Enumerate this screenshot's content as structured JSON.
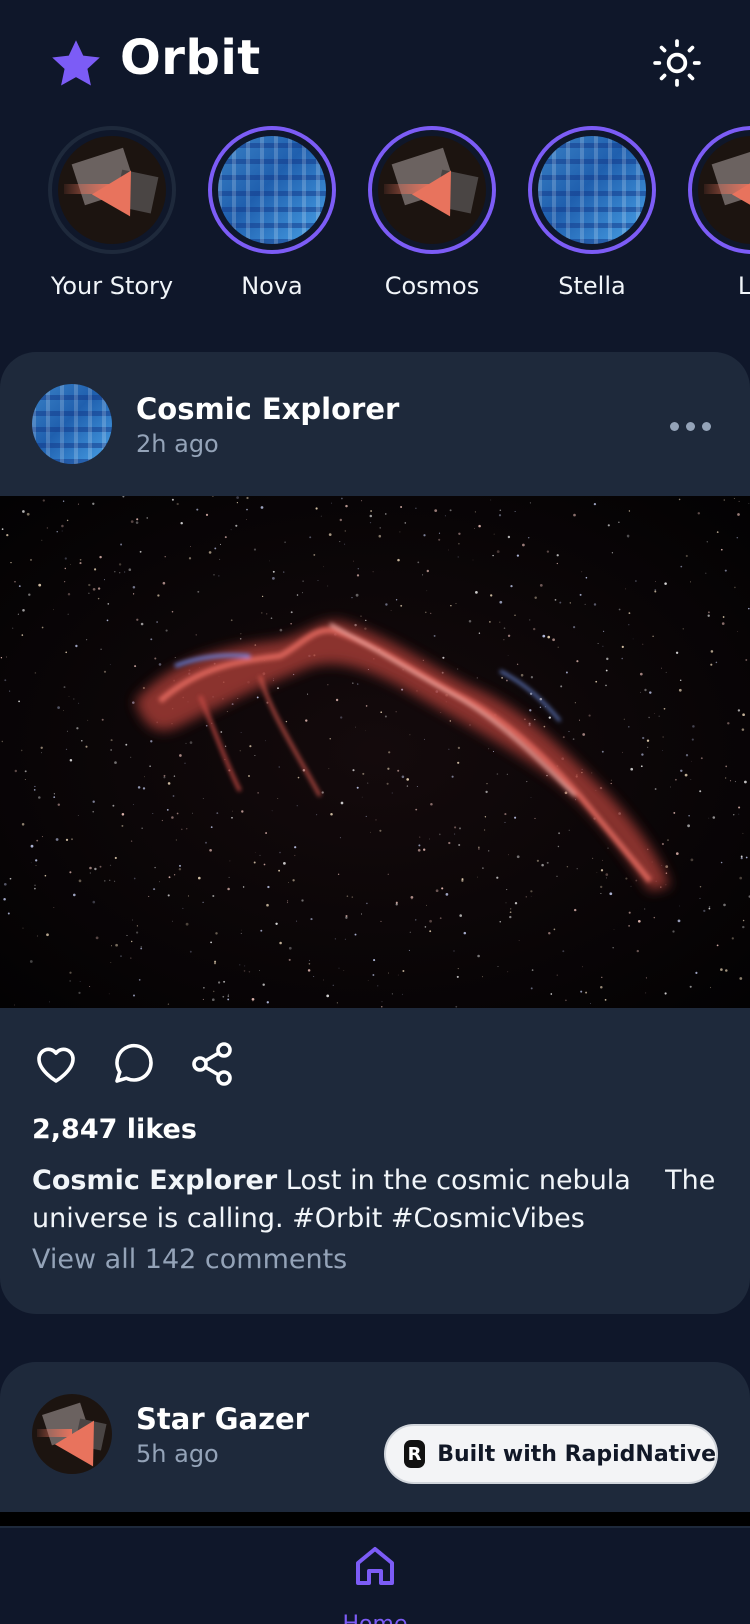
{
  "app": {
    "title": "Orbit",
    "accent_color": "#7c5cf6",
    "logo_icon": "star-icon",
    "theme_icon": "sun-icon"
  },
  "stories": [
    {
      "name": "Your Story",
      "avatar": "dark-shards",
      "own": true
    },
    {
      "name": "Nova",
      "avatar": "blue-maze"
    },
    {
      "name": "Cosmos",
      "avatar": "dark-shards"
    },
    {
      "name": "Stella",
      "avatar": "blue-maze"
    },
    {
      "name": "Lu",
      "avatar": "dark-shards"
    }
  ],
  "posts": [
    {
      "author": "Cosmic Explorer",
      "time": "2h ago",
      "avatar": "blue-maze",
      "image": "nebula photo",
      "likes": "2,847 likes",
      "caption_author": "Cosmic Explorer",
      "caption_text": " Lost in the cosmic nebula    The universe is calling. #Orbit #CosmicVibes",
      "comments_link": "View all 142 comments"
    },
    {
      "author": "Star Gazer",
      "time": "5h ago",
      "avatar": "dark-shards"
    }
  ],
  "badge": {
    "label": "Built with RapidNative",
    "logo_letter": "R"
  },
  "nav": {
    "home_label": "Home"
  }
}
